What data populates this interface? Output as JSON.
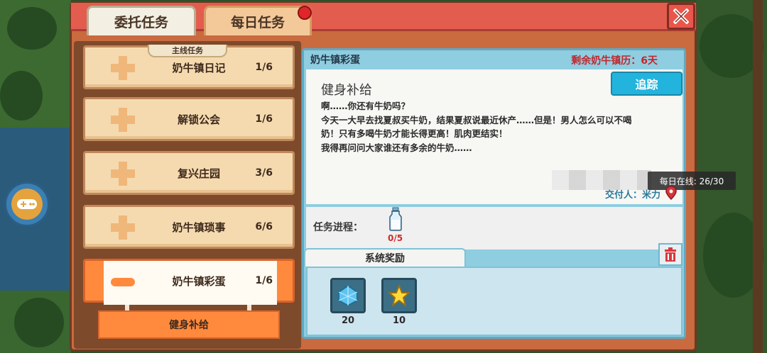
{
  "tabs": {
    "commission": "委托任务",
    "daily": "每日任务"
  },
  "quest_list": {
    "section_label": "主线任务",
    "items": [
      {
        "name": "奶牛镇日记",
        "progress": "1/6"
      },
      {
        "name": "解锁公会",
        "progress": "1/6"
      },
      {
        "name": "复兴庄园",
        "progress": "3/6"
      },
      {
        "name": "奶牛镇琐事",
        "progress": "6/6"
      },
      {
        "name": "奶牛镇彩蛋",
        "progress": "1/6"
      }
    ],
    "sub_quest": "健身补给"
  },
  "detail": {
    "category": "奶牛镇彩蛋",
    "days_left": "剩余奶牛镇历：6天",
    "quest_title": "健身补给",
    "track_button": "追踪",
    "dialogue": [
      "啊……你还有牛奶吗？",
      "今天一大早去找夏叔买牛奶，结果夏叔说最近休产……但是！男人怎么可以不喝",
      "奶！只有多喝牛奶才能长得更高！肌肉更结实！",
      "我得再问问大家谁还有多余的牛奶……"
    ],
    "giver": "交付人：米力",
    "progress_label": "任务进程：",
    "progress_value": "0/5",
    "rewards_tab": "系统奖励",
    "rewards": [
      {
        "icon": "blue-gem-icon",
        "qty": "20"
      },
      {
        "icon": "star-icon",
        "qty": "10"
      }
    ]
  },
  "overlay": {
    "daily_online": "每日在线: 26/30"
  },
  "colors": {
    "window_bg": "#c96a3f",
    "titlebar": "#e35d4e",
    "quest_card": "#f5dab0",
    "active_orange": "#ff8a3d",
    "detail_panel": "#8fcde0",
    "track_button": "#22b4dd",
    "days_left_red": "#c0272d"
  }
}
